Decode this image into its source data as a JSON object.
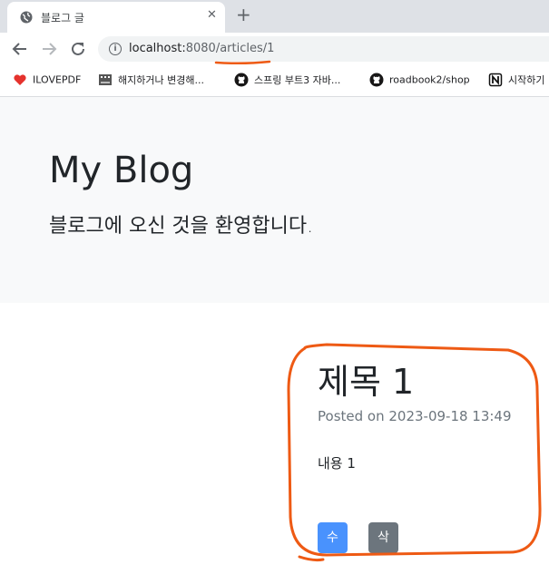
{
  "browser": {
    "tab_title": "블로그 글",
    "close_glyph": "✕",
    "new_tab_glyph": "+",
    "url_host": "localhost:",
    "url_port": "8080",
    "url_path": "/articles/1",
    "bookmarks": [
      {
        "label": "ILOVEPDF",
        "icon": "heart-icon"
      },
      {
        "label": "해지하거나 변경해...",
        "icon": "film-icon"
      },
      {
        "label": "스프링 부트3 자바...",
        "icon": "github-icon"
      },
      {
        "label": "roadbook2/shop",
        "icon": "github-icon"
      },
      {
        "label": "시작하기",
        "icon": "notion-icon"
      }
    ]
  },
  "page": {
    "blog_title": "My Blog",
    "blog_subtitle": "블로그에 오신 것을 환영합니다.",
    "article": {
      "title": "제목 1",
      "meta": "Posted on 2023-09-18 13:49",
      "content": "내용 1",
      "edit_label": "수정",
      "delete_label": "삭제"
    }
  },
  "colors": {
    "edit_button": "#0d6efd",
    "delete_button": "#6c757d",
    "hero_background": "#f8f9fa",
    "annotation": "#ee5a14"
  }
}
